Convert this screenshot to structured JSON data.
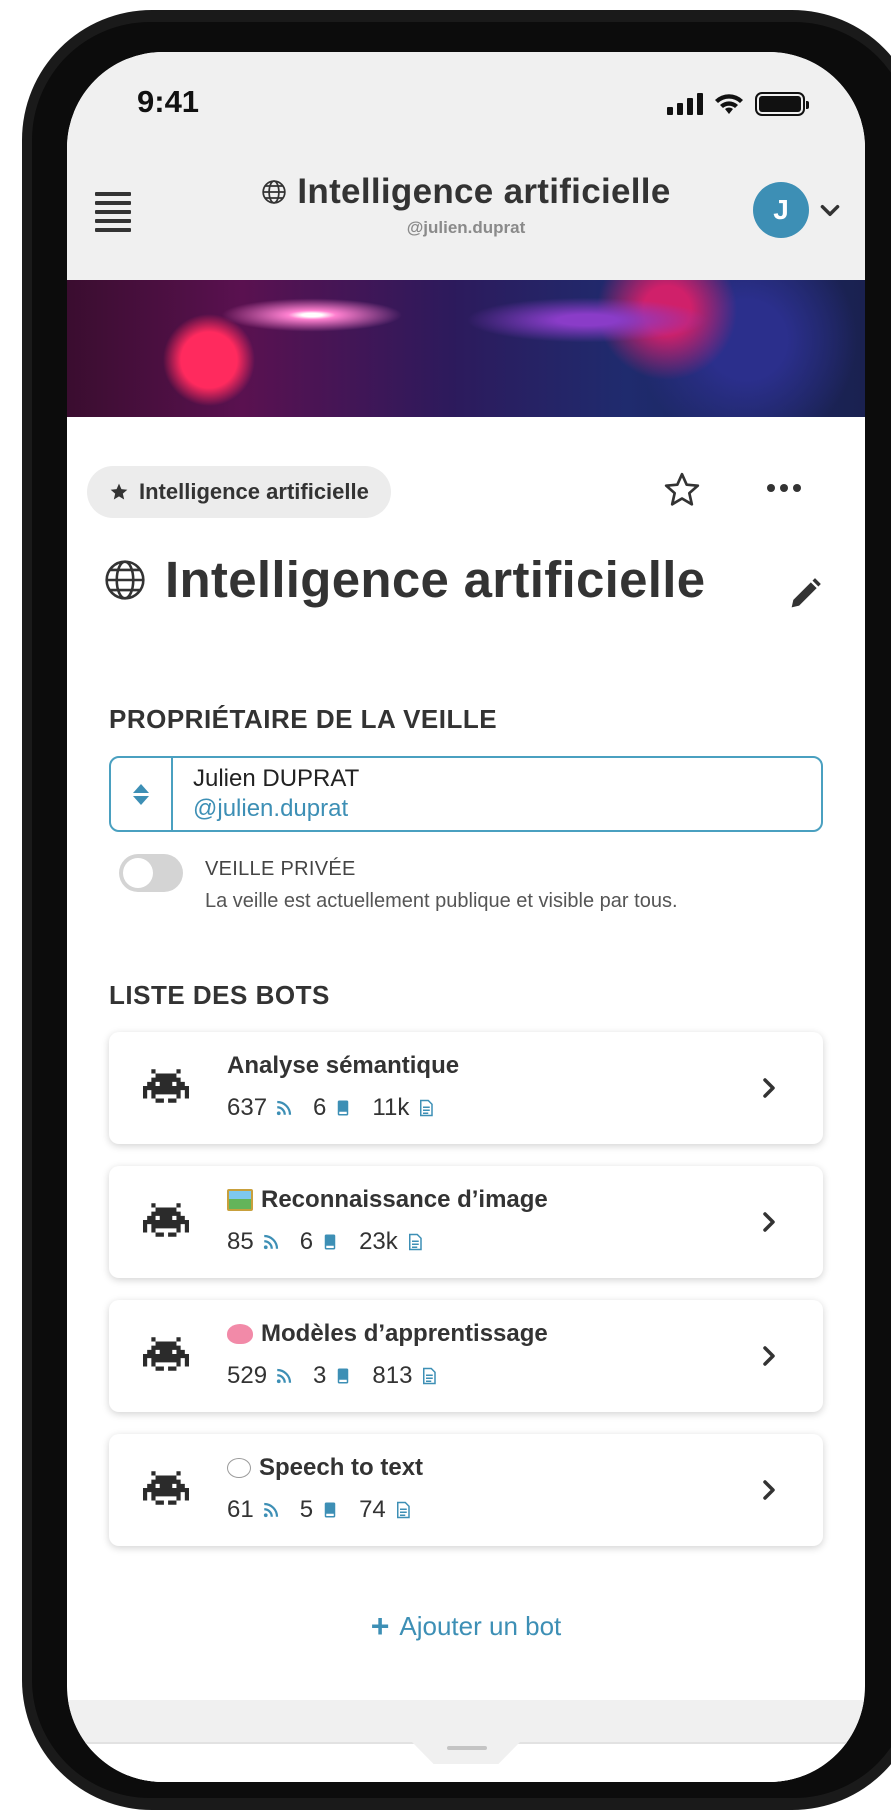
{
  "status_bar": {
    "time": "9:41"
  },
  "header": {
    "title": "Intelligence artificielle",
    "subtitle": "@julien.duprat",
    "avatar_initial": "J"
  },
  "tag_chip": {
    "label": "Intelligence artificielle"
  },
  "page_title": "Intelligence artificielle",
  "owner_section": {
    "heading": "PROPRIÉTAIRE DE LA VEILLE",
    "owner_name": "Julien DUPRAT",
    "owner_handle": "@julien.duprat"
  },
  "privacy": {
    "label": "VEILLE PRIVÉE",
    "description": "La veille est actuellement publique et visible par tous.",
    "enabled": false
  },
  "bots_section": {
    "heading": "LISTE DES BOTS",
    "bots": [
      {
        "name": "Analyse sémantique",
        "emoji": "",
        "feeds": "637",
        "collections": "6",
        "documents": "11k"
      },
      {
        "name": "Reconnaissance d’image",
        "emoji": "picture-emoji",
        "feeds": "85",
        "collections": "6",
        "documents": "23k"
      },
      {
        "name": "Modèles d’apprentissage",
        "emoji": "brain-emoji",
        "feeds": "529",
        "collections": "3",
        "documents": "813"
      },
      {
        "name": "Speech to text",
        "emoji": "speech-bubble-emoji",
        "feeds": "61",
        "collections": "5",
        "documents": "74"
      }
    ],
    "add_label": "Ajouter un bot"
  },
  "colors": {
    "accent": "#3d8fb5",
    "header_bg": "#f0f0f0",
    "text_dark": "#333333",
    "chip_bg": "#ececec",
    "toggle_off": "#d4d4d4"
  },
  "icons": {
    "menu": "hamburger-icon",
    "globe": "globe-icon",
    "star": "star-outline-icon",
    "more": "more-horizontal-icon",
    "edit": "pencil-icon",
    "bot": "space-invader-icon",
    "feed": "rss-icon",
    "collection": "book-icon",
    "document": "document-icon",
    "chevron": "chevron-right-icon"
  }
}
